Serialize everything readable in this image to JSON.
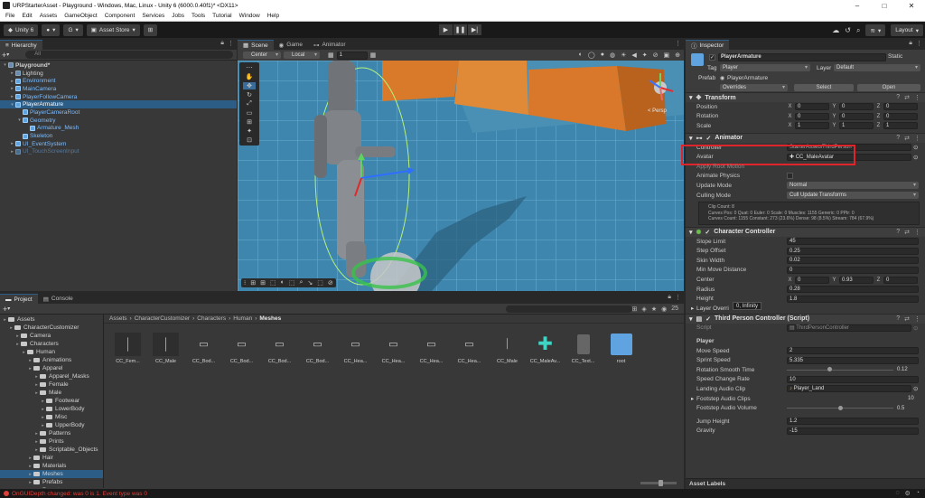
{
  "window": {
    "title": "URPStarterAsset - Playground - Windows, Mac, Linux - Unity 6 (6000.0.40f1)* <DX11>"
  },
  "menu": [
    "File",
    "Edit",
    "Assets",
    "GameObject",
    "Component",
    "Services",
    "Jobs",
    "Tools",
    "Tutorial",
    "Window",
    "Help"
  ],
  "toolbar": {
    "unity_label": "Unity 6",
    "asset_store_label": "Asset Store",
    "layout_label": "Layout"
  },
  "hierarchy": {
    "tab_label": "Hierarchy",
    "search_placeholder": "All",
    "items": [
      {
        "label": "Playground*",
        "depth": 0,
        "kind": "scene",
        "expanded": true
      },
      {
        "label": "Lighting",
        "depth": 1,
        "kind": "object"
      },
      {
        "label": "Environment",
        "depth": 1,
        "kind": "prefab"
      },
      {
        "label": "MainCamera",
        "depth": 1,
        "kind": "prefab"
      },
      {
        "label": "PlayerFollowCamera",
        "depth": 1,
        "kind": "prefab"
      },
      {
        "label": "PlayerArmature",
        "depth": 1,
        "kind": "prefab",
        "selected": true
      },
      {
        "label": "PlayerCameraRoot",
        "depth": 2,
        "kind": "prefab"
      },
      {
        "label": "Geometry",
        "depth": 2,
        "kind": "prefab"
      },
      {
        "label": "Armature_Mesh",
        "depth": 3,
        "kind": "prefab"
      },
      {
        "label": "Skeleton",
        "depth": 2,
        "kind": "prefab"
      },
      {
        "label": "UI_EventSystem",
        "depth": 1,
        "kind": "prefab"
      },
      {
        "label": "UI_TouchScreenInput",
        "depth": 1,
        "kind": "dim"
      }
    ]
  },
  "scene": {
    "tabs": [
      "Scene",
      "Game",
      "Animator"
    ],
    "pivot": "Center",
    "space": "Local",
    "snap_value": "1",
    "gizmo_label": "< Persp"
  },
  "project": {
    "tabs": [
      "Project",
      "Console"
    ],
    "breadcrumb": [
      "Assets",
      "CharacterCustomizer",
      "Characters",
      "Human",
      "Meshes"
    ],
    "zoom_count": "25",
    "tree": [
      {
        "label": "Assets",
        "depth": 0
      },
      {
        "label": "CharacterCustomizer",
        "depth": 1
      },
      {
        "label": "Camera",
        "depth": 2
      },
      {
        "label": "Characters",
        "depth": 2
      },
      {
        "label": "Human",
        "depth": 3
      },
      {
        "label": "Animations",
        "depth": 4
      },
      {
        "label": "Apparel",
        "depth": 4
      },
      {
        "label": "Apparel_Masks",
        "depth": 5
      },
      {
        "label": "Female",
        "depth": 5
      },
      {
        "label": "Male",
        "depth": 5
      },
      {
        "label": "Footwear",
        "depth": 6
      },
      {
        "label": "LowerBody",
        "depth": 6
      },
      {
        "label": "Misc",
        "depth": 6
      },
      {
        "label": "UpperBody",
        "depth": 6
      },
      {
        "label": "Patterns",
        "depth": 5
      },
      {
        "label": "Prints",
        "depth": 5
      },
      {
        "label": "Scriptable_Objects",
        "depth": 5
      },
      {
        "label": "Hair",
        "depth": 4
      },
      {
        "label": "Materials",
        "depth": 4
      },
      {
        "label": "Meshes",
        "depth": 4,
        "selected": true
      },
      {
        "label": "Prefabs",
        "depth": 4
      },
      {
        "label": "Presets",
        "depth": 4
      }
    ],
    "assets": [
      "CC_Fem...",
      "CC_Male",
      "CC_Bod...",
      "CC_Bod...",
      "CC_Bod...",
      "CC_Bod...",
      "CC_Hea...",
      "CC_Hea...",
      "CC_Hea...",
      "CC_Hea...",
      "CC_Male",
      "CC_MaleAv...",
      "CC_Text...",
      "root"
    ]
  },
  "inspector": {
    "tab_label": "Inspector",
    "object_name": "PlayerArmature",
    "static_label": "Static",
    "tag_label": "Tag",
    "tag_value": "Player",
    "layer_label": "Layer",
    "layer_value": "Default",
    "prefab_label": "Prefab",
    "prefab_value": "PlayerArmature",
    "overrides_label": "Overrides",
    "select_label": "Select",
    "open_label": "Open",
    "transform": {
      "title": "Transform",
      "rows": [
        {
          "label": "Position",
          "x": "0",
          "y": "0",
          "z": "0"
        },
        {
          "label": "Rotation",
          "x": "0",
          "y": "0",
          "z": "0"
        },
        {
          "label": "Scale",
          "x": "1",
          "y": "1",
          "z": "1"
        }
      ]
    },
    "animator": {
      "title": "Animator",
      "controller_label": "Controller",
      "controller_value": "StarterAssetsThirdPerson",
      "avatar_label": "Avatar",
      "avatar_value": "CC_MaleAvatar",
      "apply_root_motion_label": "Apply Root Motion",
      "animate_physics_label": "Animate Physics",
      "update_mode_label": "Update Mode",
      "update_mode_value": "Normal",
      "culling_mode_label": "Culling Mode",
      "culling_mode_value": "Cull Update Transforms",
      "info": [
        "Clip Count: 8",
        "Curves Pos: 0 Quat: 0 Euler: 0 Scale: 0 Muscles: 1155 Generic: 0 PPtr: 0",
        "Curves Count: 1155 Constant: 273 (23.6%) Dense: 98 (8.5%) Stream: 784 (67.9%)"
      ]
    },
    "character_controller": {
      "title": "Character Controller",
      "rows": [
        {
          "label": "Slope Limit",
          "value": "45"
        },
        {
          "label": "Step Offset",
          "value": "0.25"
        },
        {
          "label": "Skin Width",
          "value": "0.02"
        },
        {
          "label": "Min Move Distance",
          "value": "0"
        }
      ],
      "center_label": "Center",
      "center": {
        "x": "0",
        "y": "0.93",
        "z": "0"
      },
      "radius_label": "Radius",
      "radius_value": "0.28",
      "height_label": "Height",
      "height_value": "1.8",
      "layer_overrides_label": "Layer Overri",
      "tooltip": "0, Infinity"
    },
    "third_person": {
      "title": "Third Person Controller (Script)",
      "script_label": "Script",
      "script_value": "ThirdPersonController",
      "player_header": "Player",
      "move_speed_label": "Move Speed",
      "move_speed_value": "2",
      "sprint_speed_label": "Sprint Speed",
      "sprint_speed_value": "5.335",
      "rotation_smooth_label": "Rotation Smooth Time",
      "rotation_smooth_value": "0.12",
      "rotation_smooth_fraction": 0.4,
      "speed_change_label": "Speed Change Rate",
      "speed_change_value": "10",
      "landing_clip_label": "Landing Audio Clip",
      "landing_clip_value": "Player_Land",
      "footstep_clips_label": "Footstep Audio Clips",
      "footstep_clips_value": "10",
      "footstep_volume_label": "Footstep Audio Volume",
      "footstep_volume_value": "0.5",
      "footstep_volume_fraction": 0.5,
      "jump_height_label": "Jump Height",
      "jump_height_value": "1.2",
      "gravity_label": "Gravity",
      "gravity_value": "-15"
    },
    "asset_labels": "Asset Labels"
  },
  "status": {
    "message": "OnGUIDepth changed: was 0 is 1. Event type was 0"
  },
  "colors": {
    "selection": "#2c5d87",
    "highlight_box": "#e0242b",
    "error": "#e0403a"
  }
}
